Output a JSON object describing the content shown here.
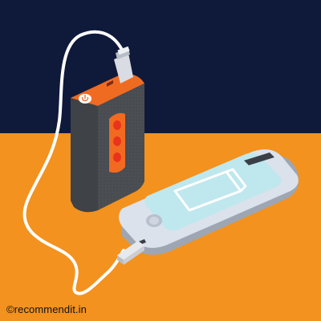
{
  "scene": {
    "subject": "power-bank-charging-smartphone",
    "colors": {
      "sky": "#0f1a3a",
      "floor": "#f3921e",
      "bank_body": "#4a4d52",
      "bank_accent": "#f26a21",
      "bank_lights": "#e8341c",
      "phone_body": "#d7dee8",
      "phone_screen": "#bfe7ee",
      "cable": "#ffffff"
    },
    "phone_battery_icon": "battery-empty-icon",
    "credit": "©recommendit.in"
  }
}
